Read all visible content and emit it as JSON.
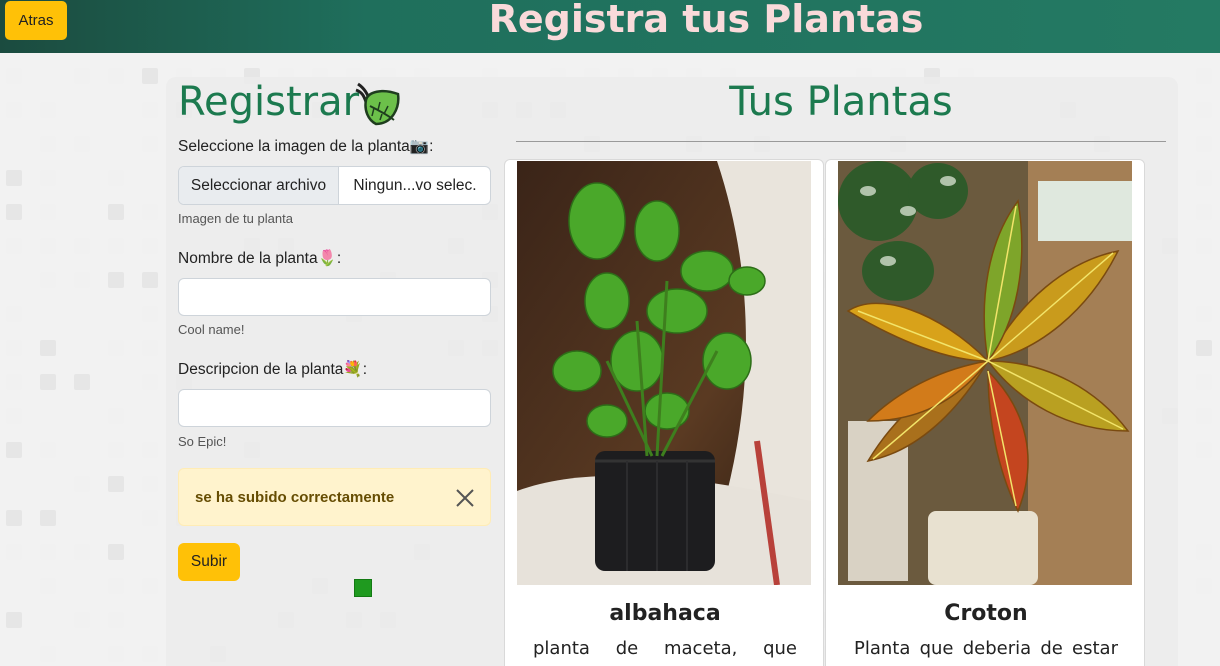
{
  "header": {
    "back_label": "Atras",
    "title": "Registra tus Plantas"
  },
  "form": {
    "title": "Registrar",
    "image_label": "Seleccione la imagen de la planta📷:",
    "file_button": "Seleccionar archivo",
    "file_name": "Ningun...vo selec.",
    "image_hint": "Imagen de tu planta",
    "name_label": "Nombre de la planta🌷:",
    "name_value": "",
    "name_hint": "Cool name!",
    "desc_label": "Descripcion de la planta💐:",
    "desc_value": "",
    "desc_hint": "So Epic!",
    "alert_text": "se ha subido correctamente",
    "submit_label": "Subir"
  },
  "plants": {
    "title": "Tus Plantas",
    "cards": [
      {
        "name": "albahaca",
        "description": "planta de maceta, que"
      },
      {
        "name": "Croton",
        "description": "Planta que deberia de estar"
      }
    ]
  },
  "colors": {
    "accent": "#ffc107",
    "title_green": "#1c7a4f",
    "header": "#247a63",
    "alert_bg": "#fff3cd"
  }
}
